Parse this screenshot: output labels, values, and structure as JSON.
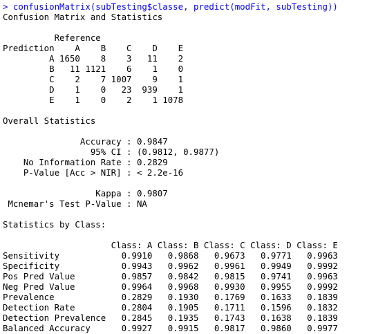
{
  "console": {
    "command": "> confusionMatrix(subTesting$classe, predict(modFit, subTesting))",
    "lines": [
      "Confusion Matrix and Statistics",
      "",
      "          Reference",
      "Prediction    A    B    C    D    E",
      "         A 1650    8    3   11    2",
      "         B   11 1121    6    1    0",
      "         C    2    7 1007    9    1",
      "         D    1    0   23  939    1",
      "         E    1    0    2    1 1078",
      "",
      "Overall Statistics",
      "",
      "               Accuracy : 0.9847",
      "                 95% CI : (0.9812, 0.9877)",
      "    No Information Rate : 0.2829",
      "    P-Value [Acc > NIR] : < 2.2e-16",
      "",
      "                  Kappa : 0.9807",
      " Mcnemar's Test P-Value : NA",
      "",
      "Statistics by Class:",
      "",
      "                     Class: A Class: B Class: C Class: D Class: E",
      "Sensitivity            0.9910   0.9868   0.9673   0.9771   0.9963",
      "Specificity            0.9943   0.9962   0.9961   0.9949   0.9992",
      "Pos Pred Value         0.9857   0.9842   0.9815   0.9741   0.9963",
      "Neg Pred Value         0.9964   0.9968   0.9930   0.9955   0.9992",
      "Prevalence             0.2829   0.1930   0.1769   0.1633   0.1839",
      "Detection Rate         0.2804   0.1905   0.1711   0.1596   0.1832",
      "Detection Prevalence   0.2845   0.1935   0.1743   0.1638   0.1839",
      "Balanced Accuracy      0.9927   0.9915   0.9817   0.9860   0.9977"
    ],
    "colors": {
      "command": "#0000ff",
      "output": "#000000",
      "background": "#ffffff"
    }
  }
}
